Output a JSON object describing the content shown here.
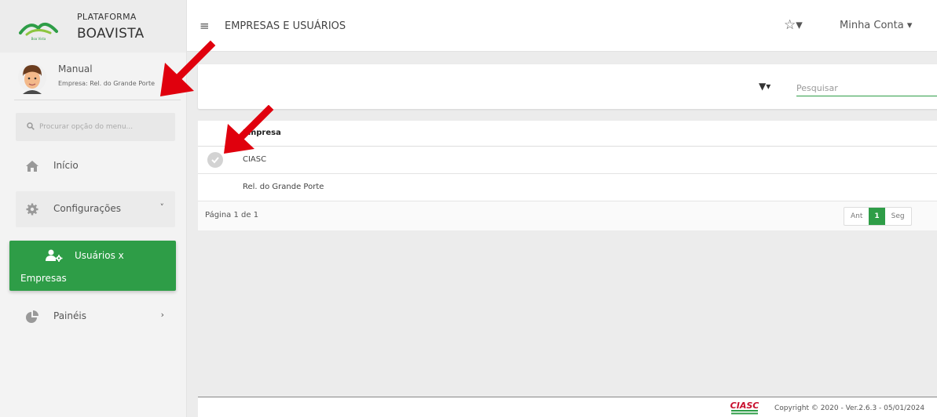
{
  "brand": {
    "line1": "PLATAFORMA",
    "line2": "BOAVISTA",
    "logo_text": "Boa Vista"
  },
  "user": {
    "name": "Manual",
    "company": "Empresa: Rel. do Grande Porte"
  },
  "menu_search": {
    "placeholder": "Procurar opção do menu..."
  },
  "nav": {
    "inicio": "Início",
    "configuracoes": "Configurações",
    "active_line1": "Usuários x",
    "active_line2": "Empresas",
    "paineis": "Painéis"
  },
  "topbar": {
    "hamburger": "≡",
    "title": "EMPRESAS E USUÁRIOS",
    "star": "☆▾",
    "account": "Minha Conta ▾"
  },
  "filter": {
    "icon": "▼▾",
    "search_placeholder": "Pesquisar"
  },
  "table": {
    "header": "Empresa",
    "rows": [
      {
        "name": "CIASC"
      },
      {
        "name": "Rel. do Grande Porte"
      }
    ],
    "pagination_text": "Página 1 de 1",
    "prev_label": "Ant",
    "current_page": "1",
    "next_label": "Seg"
  },
  "footer": {
    "logo": "CIASC",
    "copyright": "Copyright © 2020 - Ver.2.6.3 - 05/01/2024"
  },
  "colors": {
    "accent": "#2e9d47",
    "annotation": "#e0000d"
  }
}
